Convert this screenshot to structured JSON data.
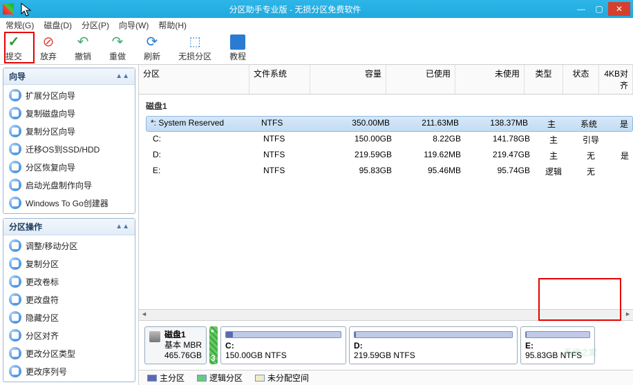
{
  "window": {
    "title": "分区助手专业版 - 无损分区免费软件"
  },
  "menu": {
    "general": "常规(G)",
    "disk": "磁盘(D)",
    "partition": "分区(P)",
    "wizard": "向导(W)",
    "help": "帮助(H)"
  },
  "toolbar": {
    "submit": "提交",
    "abandon": "放弃",
    "undo": "撤销",
    "redo": "重做",
    "refresh": "刷新",
    "lossless": "无损分区",
    "tutorial": "教程"
  },
  "panels": {
    "wizard": {
      "title": "向导",
      "items": [
        "扩展分区向导",
        "复制磁盘向导",
        "复制分区向导",
        "迁移OS到SSD/HDD",
        "分区恢复向导",
        "启动光盘制作向导",
        "Windows To Go创建器"
      ]
    },
    "ops": {
      "title": "分区操作",
      "items": [
        "调整/移动分区",
        "复制分区",
        "更改卷标",
        "更改盘符",
        "隐藏分区",
        "分区对齐",
        "更改分区类型",
        "更改序列号"
      ]
    }
  },
  "columns": {
    "name": "分区",
    "fs": "文件系统",
    "cap": "容量",
    "used": "已使用",
    "free": "未使用",
    "ptype": "类型",
    "status": "状态",
    "align": "4KB对齐"
  },
  "disk": {
    "header": "磁盘1",
    "rows": [
      {
        "name": "*: System Reserved",
        "fs": "NTFS",
        "cap": "350.00MB",
        "used": "211.63MB",
        "free": "138.37MB",
        "ptype": "主",
        "status": "系统",
        "align": "是"
      },
      {
        "name": "C:",
        "fs": "NTFS",
        "cap": "150.00GB",
        "used": "8.22GB",
        "free": "141.78GB",
        "ptype": "主",
        "status": "引导",
        "align": ""
      },
      {
        "name": "D:",
        "fs": "NTFS",
        "cap": "219.59GB",
        "used": "119.62MB",
        "free": "219.47GB",
        "ptype": "主",
        "status": "无",
        "align": "是"
      },
      {
        "name": "E:",
        "fs": "NTFS",
        "cap": "95.83GB",
        "used": "95.46MB",
        "free": "95.74GB",
        "ptype": "逻辑",
        "status": "无",
        "align": ""
      }
    ]
  },
  "map": {
    "disk": {
      "name": "磁盘1",
      "type": "基本 MBR",
      "size": "465.76GB"
    },
    "spacer": {
      "top": "*",
      "bottom": "3"
    },
    "c": {
      "label": "C:",
      "detail": "150.00GB NTFS",
      "fill_pct": 6
    },
    "d": {
      "label": "D:",
      "detail": "219.59GB NTFS",
      "fill_pct": 1
    },
    "e": {
      "label": "E:",
      "detail": "95.83GB NTFS",
      "fill_pct": 1
    }
  },
  "legend": {
    "primary": "主分区",
    "logical": "逻辑分区",
    "unalloc": "未分配空间"
  },
  "watermark": "系统之家"
}
